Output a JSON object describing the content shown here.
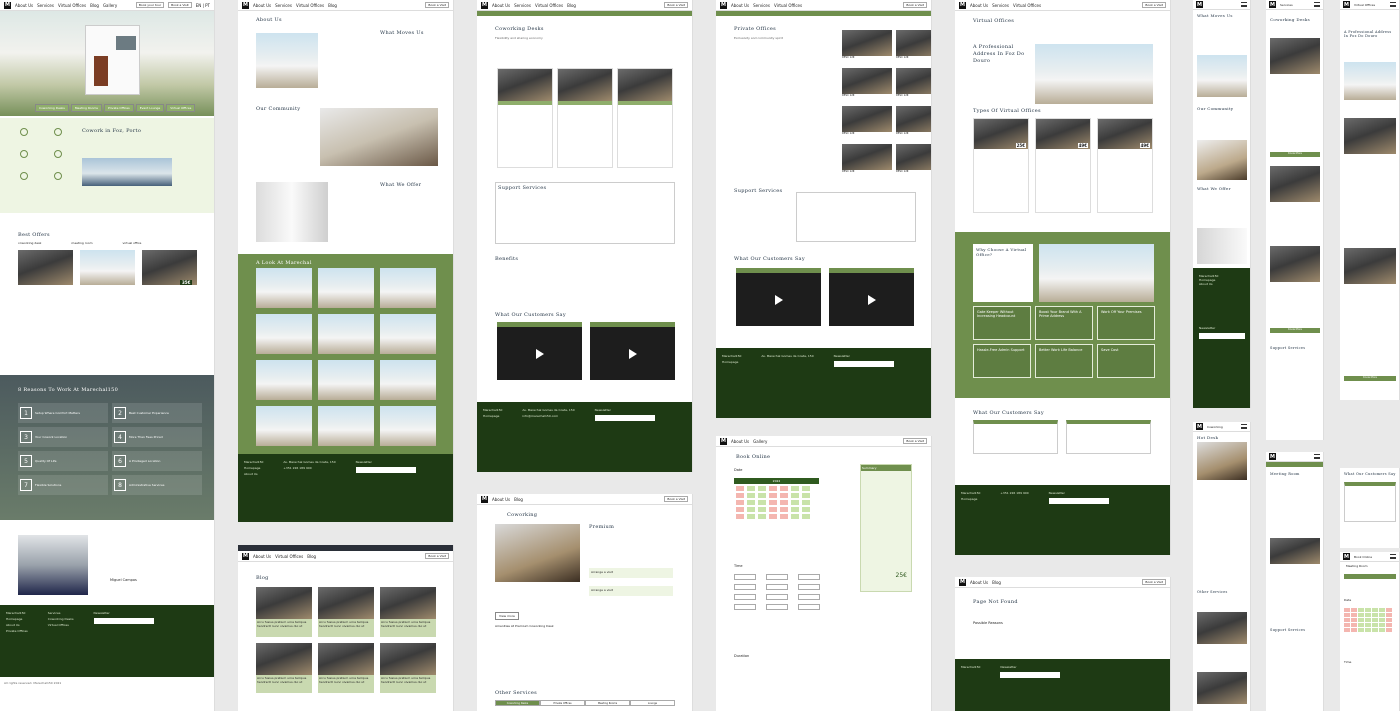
{
  "nav": {
    "about": "About Us",
    "services": "Services",
    "virtual": "Virtual Offices",
    "blog": "Blog",
    "gallery": "Gallery",
    "book_tour": "Book your tour",
    "book_visit": "Book a Visit",
    "lang": "EN | PT"
  },
  "home": {
    "services": [
      "Coworking Desks",
      "Meeting Rooms",
      "Private Offices",
      "Event Lounge",
      "Virtual Offices"
    ],
    "coworking_title": "Cowork in Foz, Porto",
    "best_offers": "Best Offers",
    "offer_labels": [
      "coworking desk",
      "meeting room",
      "virtual office"
    ],
    "reasons_title": "8 Reasons To Work At Marechal150",
    "reasons": [
      {
        "n": "1",
        "t": "Setup Where Comfort Matters"
      },
      {
        "n": "2",
        "t": "Best Customer Experience"
      },
      {
        "n": "3",
        "t": "Your Cowork Location"
      },
      {
        "n": "4",
        "t": "More Than Fees Priced"
      },
      {
        "n": "5",
        "t": "Quality Of Life"
      },
      {
        "n": "6",
        "t": "A Privileged Location"
      },
      {
        "n": "7",
        "t": "Flexible Solutions"
      },
      {
        "n": "8",
        "t": "Administrative Services"
      }
    ],
    "person_name": "Miguel Campos",
    "price": "35€"
  },
  "about": {
    "title": "About Us",
    "moves": "What Moves Us",
    "community": "Our Community",
    "offer": "What We Offer",
    "look": "A Look At Marechal"
  },
  "blog": {
    "title": "Blog",
    "card_text": "Arcu fusius pretium urna tempus hendrerit nunc vivamus dui ut"
  },
  "coworking": {
    "title": "Coworking Desks",
    "subtitle": "Flexibility and sharing economy",
    "support": "Support Services",
    "benefits": "Benefits",
    "testimonials": "What Our Customers Say",
    "premium": "Premium",
    "arrange1": "Arrange a visit",
    "arrange2": "Arrange a visit",
    "amenities": "Amenities At Premium Coworking Desk",
    "other": "Other Services",
    "tabs": [
      "Coworking Desks",
      "Private Offices",
      "Meeting Rooms",
      "Lounge"
    ],
    "view_more": "View more"
  },
  "private": {
    "title": "Private Offices",
    "subtitle": "Exclusivity and community spirit",
    "support": "Support Services",
    "testimonials": "What Our Customers Say",
    "prices": [
      "DESC 12€",
      "DESC 12€",
      "DESC 12€",
      "DESC 12€",
      "DESC 12€",
      "DESC 12€",
      "DESC 12€",
      "DESC 12€"
    ]
  },
  "booking": {
    "title": "Book Online",
    "date": "Date",
    "time": "Time",
    "duration": "Duration",
    "month": "2022",
    "summary": "Summary",
    "total": "25€"
  },
  "virtual": {
    "title": "Virtual Offices",
    "address": "A Professional Address In Foz Do Douro",
    "types": "Types Of Virtual Offices",
    "prices": [
      "25€",
      "49€",
      "49€"
    ],
    "why": "Why Choose A Virtual Office?",
    "tiles": [
      "Gate Keeper Without Increasing Headcount",
      "Boost Your Brand With A Prime Address",
      "Work Off Your Premises",
      "Hassle-Free Admin Support",
      "Better Work Life Balance",
      "Save Cost"
    ],
    "testimonials": "What Our Customers Say",
    "not_found": "Page Not Found",
    "possible": "Possible Reasons"
  },
  "mobile": {
    "about": "About Us",
    "moves": "What Moves Us",
    "community": "Our Community",
    "offer": "What We Offer",
    "coworking": "Coworking",
    "hot_desk": "Hot Desk",
    "meeting": "Meeting Room",
    "services": "Services",
    "virtual": "Virtual Offices",
    "book": "Book Online",
    "address": "A Professional Address In Foz Do Douro",
    "btn": "Know More",
    "other": "Other Services",
    "support": "Support Services",
    "testimonials": "What Our Customers Say"
  },
  "footer": {
    "brand": "Marechal150",
    "links": [
      "Homepage",
      "About Us",
      "Private Offices",
      "Gallery"
    ],
    "services_label": "Services",
    "services": [
      "Coworking Desks",
      "Virtual Offices",
      "Meeting Rooms",
      "Event Lounge"
    ],
    "address": "Av. Marechal Gomes da Costa, 150",
    "phone": "+351 226 189 900",
    "email": "info@marechal150.com",
    "newsletter": "Newsletter",
    "copyright": "All rights reserved. Marechal150 2021"
  },
  "colors": {
    "accent": "#6f8f4d",
    "dark": "#1e3a14",
    "light": "#c9d9b0"
  }
}
